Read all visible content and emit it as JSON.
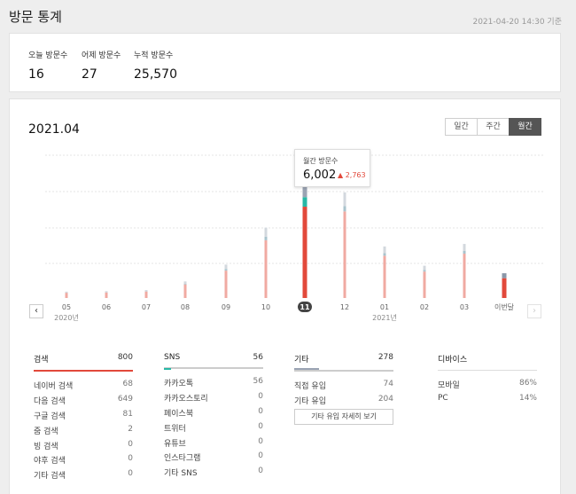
{
  "header": {
    "title": "방문 통계",
    "timestamp": "2021-04-20 14:30 기준"
  },
  "summary": {
    "today": {
      "label": "오늘 방문수",
      "value": "16"
    },
    "yesterday": {
      "label": "어제 방문수",
      "value": "27"
    },
    "total": {
      "label": "누적 방문수",
      "value": "25,570"
    }
  },
  "period": {
    "title": "2021.04",
    "tabs": [
      {
        "label": "일간",
        "active": false
      },
      {
        "label": "주간",
        "active": false
      },
      {
        "label": "월간",
        "active": true
      }
    ]
  },
  "tooltip": {
    "label": "월간 방문수",
    "value": "6,002",
    "delta": "▲ 2,763"
  },
  "chart_data": {
    "type": "bar",
    "categories": [
      "05",
      "06",
      "07",
      "08",
      "09",
      "10",
      "11",
      "12",
      "01",
      "02",
      "03",
      "이번달"
    ],
    "year_labels": [
      {
        "text": "2020년",
        "under_index": 0
      },
      {
        "text": "2021년",
        "under_index": 8
      }
    ],
    "selected_index": 6,
    "values": [
      280,
      300,
      350,
      730,
      1470,
      3100,
      6002,
      4650,
      2270,
      1420,
      2380,
      1090
    ],
    "ylim": [
      0,
      6600
    ],
    "stack_colors": [
      "#f0aaa2",
      "#a9c3cc",
      "#d3d8de"
    ],
    "selected_stack_colors": [
      "#e2493b",
      "#28b8a6",
      "#9aa3b3"
    ],
    "current_month_colors": [
      "#e2493b",
      "#8a97a8"
    ],
    "grid": true
  },
  "sources": {
    "search": {
      "title": "검색",
      "count": "800",
      "accent": "#e2493b",
      "rows": [
        {
          "label": "네이버 검색",
          "value": "68"
        },
        {
          "label": "다음 검색",
          "value": "649"
        },
        {
          "label": "구글 검색",
          "value": "81"
        },
        {
          "label": "줌 검색",
          "value": "2"
        },
        {
          "label": "빙 검색",
          "value": "0"
        },
        {
          "label": "야후 검색",
          "value": "0"
        },
        {
          "label": "기타 검색",
          "value": "0"
        }
      ]
    },
    "sns": {
      "title": "SNS",
      "count": "56",
      "accent": "#28b8a6",
      "rows": [
        {
          "label": "카카오톡",
          "value": "56"
        },
        {
          "label": "카카오스토리",
          "value": "0"
        },
        {
          "label": "페이스북",
          "value": "0"
        },
        {
          "label": "트위터",
          "value": "0"
        },
        {
          "label": "유튜브",
          "value": "0"
        },
        {
          "label": "인스타그램",
          "value": "0"
        },
        {
          "label": "기타 SNS",
          "value": "0"
        }
      ]
    },
    "other": {
      "title": "기타",
      "count": "278",
      "accent": "#9aa3b3",
      "rows": [
        {
          "label": "직접 유입",
          "value": "74"
        },
        {
          "label": "기타 유입",
          "value": "204"
        }
      ],
      "detail_button": "기타 유입 자세히 보기"
    },
    "device": {
      "title": "디바이스",
      "count": "",
      "accent": "#dddddd",
      "rows": [
        {
          "label": "모바일",
          "value": "86%"
        },
        {
          "label": "PC",
          "value": "14%"
        }
      ]
    }
  },
  "icons": {
    "prev": "chevron-left-icon",
    "next": "chevron-right-icon"
  }
}
